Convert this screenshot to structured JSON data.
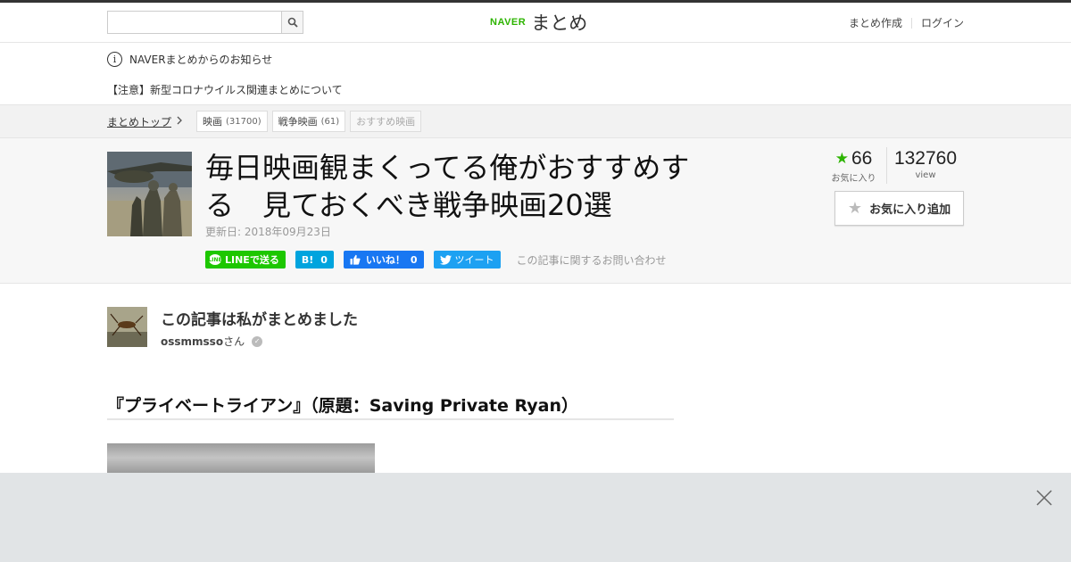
{
  "header": {
    "search_placeholder": "",
    "logo_brand": "NAVER",
    "logo_service": "まとめ",
    "links": [
      "まとめ作成",
      "ログイン"
    ]
  },
  "notice": {
    "title": "NAVERまとめからのお知らせ",
    "item": "【注意】新型コロナウイルス関連まとめについて"
  },
  "breadcrumb": {
    "top": "まとめトップ",
    "tags": [
      {
        "label": "映画",
        "count": "(31700)"
      },
      {
        "label": "戦争映画",
        "count": "(61)"
      },
      {
        "label": "おすすめ映画",
        "count": ""
      }
    ]
  },
  "article": {
    "title": "毎日映画観まくってる俺がおすすめする　見ておくべき戦争映画20選",
    "updated": "更新日: 2018年09月23日",
    "share": {
      "line": "LINEで送る",
      "hatena_label": "B!",
      "hatena_count": "0",
      "fb_label": "いいね！",
      "fb_count": "0",
      "tweet": "ツイート"
    },
    "inquiry": "この記事に関するお問い合わせ",
    "favorites": "66",
    "favorites_label": "お気に入り",
    "views": "132760",
    "views_label": "view",
    "fav_button": "お気に入り追加"
  },
  "author": {
    "heading": "この記事は私がまとめました",
    "name": "ossmmsso",
    "suffix": "さん"
  },
  "section": {
    "heading": "『プライベートライアン』（原題：Saving Private Ryan）"
  },
  "colors": {
    "brand_green": "#2db400",
    "line_green": "#1dc700",
    "hatena_blue": "#00a4de",
    "facebook_blue": "#1877f2",
    "twitter_blue": "#1da1f2"
  }
}
